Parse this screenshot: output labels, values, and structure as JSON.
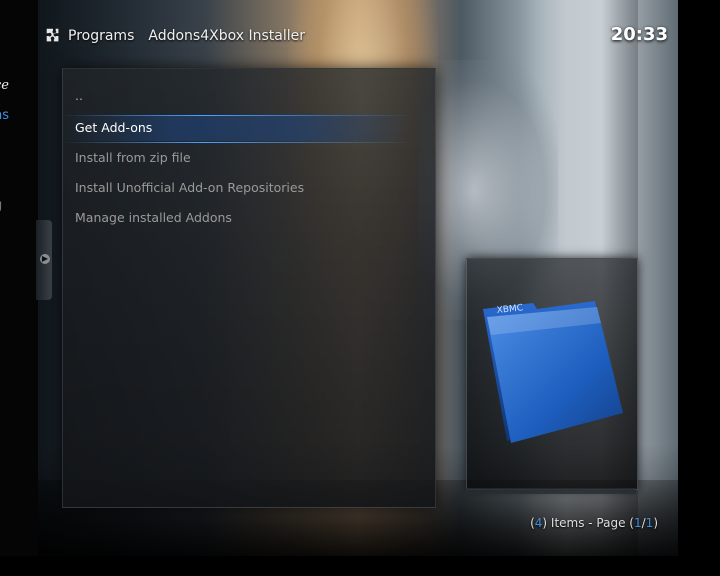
{
  "header": {
    "breadcrumb": [
      "Programs",
      "Addons4Xbox Installer"
    ],
    "clock": "20:33",
    "icon": "puzzle-icon"
  },
  "left_partial": {
    "fragments": [
      "ce",
      "ns",
      "g"
    ]
  },
  "list": {
    "items": [
      {
        "label": "..",
        "focused": false
      },
      {
        "label": "Get Add-ons",
        "focused": true
      },
      {
        "label": "Install from zip file",
        "focused": false
      },
      {
        "label": "Install Unofficial Add-on Repositories",
        "focused": false
      },
      {
        "label": "Manage installed Addons",
        "focused": false
      }
    ]
  },
  "thumbnail": {
    "icon": "xbmc-folder-icon",
    "logo_text": "XBMC"
  },
  "status": {
    "count": "4",
    "items_label": "Items - Page",
    "page": "1",
    "pages": "1"
  },
  "colors": {
    "accent": "#3f8fe0",
    "focus_bar": "#1e4682",
    "text": "#dddddd"
  }
}
